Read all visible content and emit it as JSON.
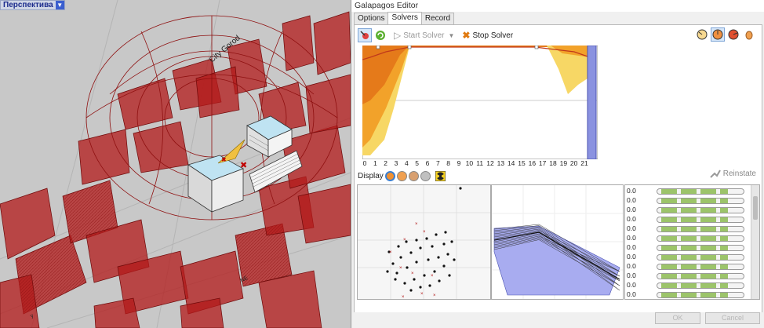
{
  "viewport": {
    "label": "Перспектива",
    "street_labels": [
      "City Gorod",
      "NE",
      "y"
    ]
  },
  "window": {
    "title": "Galapagos Editor"
  },
  "tabs": [
    "Options",
    "Solvers",
    "Record"
  ],
  "active_tab": "Solvers",
  "toolbar": {
    "start_label": "Start Solver",
    "stop_label": "Stop Solver"
  },
  "fitness_chart": {
    "x_ticks": [
      "0",
      "1",
      "2",
      "3",
      "4",
      "5",
      "6",
      "7",
      "8",
      "9",
      "10",
      "11",
      "12",
      "13",
      "14",
      "15",
      "16",
      "17",
      "18",
      "19",
      "20",
      "21"
    ]
  },
  "display": {
    "label": "Display",
    "reinstate_label": "Reinstate"
  },
  "genomes": {
    "values": [
      "0.0",
      "0.0",
      "0.0",
      "0.0",
      "0.0",
      "0.0",
      "0.0",
      "0.0",
      "0.0",
      "0.0",
      "0.0",
      "0.0"
    ]
  },
  "buttons": {
    "ok": "OK",
    "cancel": "Cancel"
  },
  "colors": {
    "accent": "#3b5fcf",
    "fitness_fill": "#f2b72a",
    "fitness_line": "#c0391b",
    "highlight": "#8a92e0"
  }
}
